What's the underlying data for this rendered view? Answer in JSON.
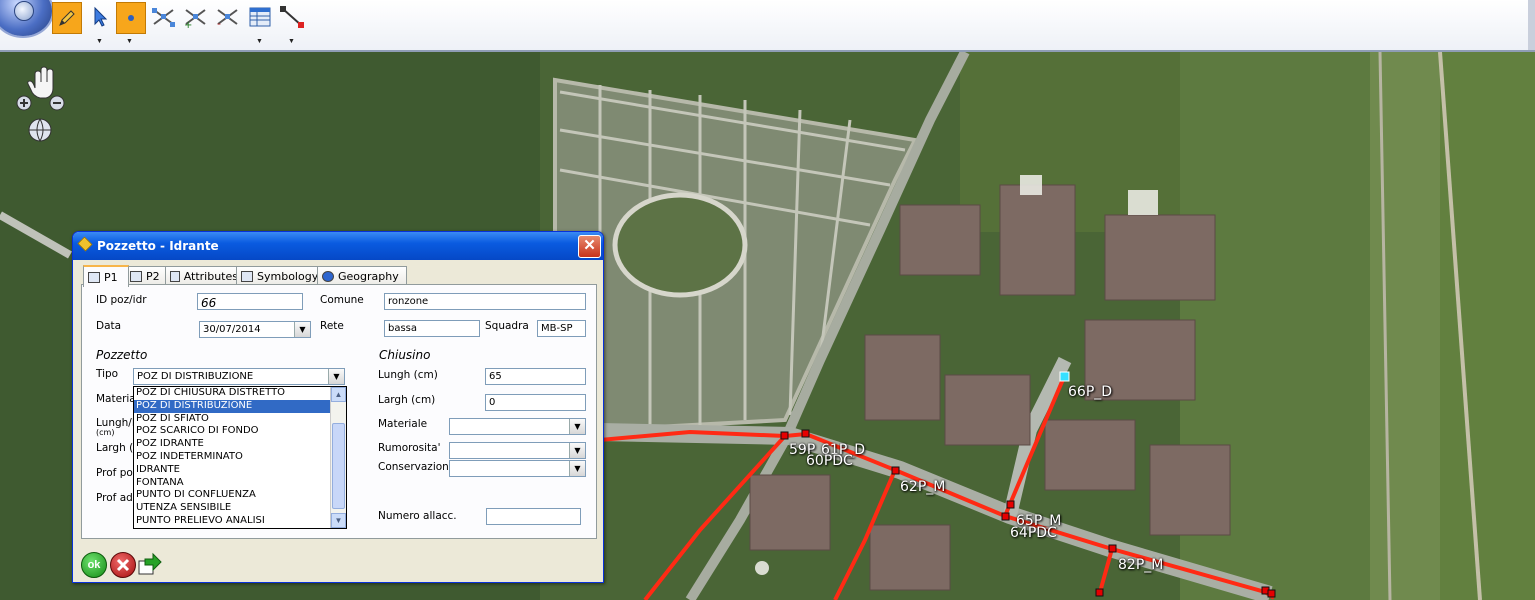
{
  "toolbar": {
    "tools": [
      {
        "name": "draw-tool",
        "icon": "pencil-icon",
        "active": true
      },
      {
        "name": "select-tool",
        "icon": "pointer-icon",
        "active": false
      },
      {
        "name": "point-tool",
        "icon": "point-icon",
        "active": true
      },
      {
        "name": "edit-vertices-tool",
        "icon": "vertices-icon",
        "active": false
      },
      {
        "name": "add-vertex-tool",
        "icon": "add-vertex-icon",
        "active": false
      },
      {
        "name": "remove-vertex-tool",
        "icon": "remove-vertex-icon",
        "active": false
      },
      {
        "name": "attribute-table-tool",
        "icon": "table-icon",
        "active": false
      },
      {
        "name": "line-tool",
        "icon": "line-icon",
        "active": false
      }
    ]
  },
  "map": {
    "labels": {
      "l66p_d": "66P_D",
      "l59": "59P",
      "l61p_d": "61P_D",
      "l60pdc": "60PDC",
      "l62p_m": "62P_M",
      "l65p_m": "65P_M",
      "l64pdc": "64PDC",
      "l82p_m": "82P_M"
    },
    "pipe_color": "#ff2a14",
    "selected_node_color": "#36e0ff"
  },
  "dialog": {
    "title": "Pozzetto - Idrante",
    "close_glyph": "✕",
    "tabs": [
      "P1",
      "P2",
      "Attributes",
      "Symbology",
      "Geography"
    ],
    "active_tab": "P1",
    "fields": {
      "id_label": "ID poz/idr",
      "id_value": "66",
      "comune_label": "Comune",
      "comune_value": "ronzone",
      "data_label": "Data",
      "data_value": "30/07/2014",
      "rete_label": "Rete",
      "rete_value": "bassa",
      "squadra_label": "Squadra",
      "squadra_value": "MB-SP"
    },
    "pozzetto": {
      "section": "Pozzetto",
      "tipo_label": "Tipo",
      "tipo_value": "POZ DI DISTRIBUZIONE",
      "materiale_label": "Materia",
      "lungh_label": "Lungh/D",
      "lungh_unit": "(cm)",
      "largh_label": "Largh (c",
      "prof_pozzo_label": "Prof poz",
      "prof_add_label": "Prof add"
    },
    "tipo_options": [
      "POZ DI CHIUSURA DISTRETTO",
      "POZ DI DISTRIBUZIONE",
      "POZ DI SFIATO",
      "POZ SCARICO DI FONDO",
      "POZ IDRANTE",
      "POZ INDETERMINATO",
      "IDRANTE",
      "FONTANA",
      "PUNTO DI CONFLUENZA",
      "UTENZA SENSIBILE",
      "PUNTO PRELIEVO ANALISI"
    ],
    "tipo_selected_index": 1,
    "chiusino": {
      "section": "Chiusino",
      "lungh_label": "Lungh (cm)",
      "lungh_value": "65",
      "largh_label": "Largh (cm)",
      "largh_value": "0",
      "materiale_label": "Materiale",
      "materiale_value": "",
      "rumorosita_label": "Rumorosita'",
      "rumorosita_value": "",
      "conservazione_label": "Conservazione",
      "conservazione_value": "",
      "numero_allacc_label": "Numero allacc.",
      "numero_allacc_value": ""
    },
    "buttons": {
      "ok_label": "ok",
      "cancel_icon": "cancel-icon",
      "export_icon": "export-icon"
    }
  }
}
